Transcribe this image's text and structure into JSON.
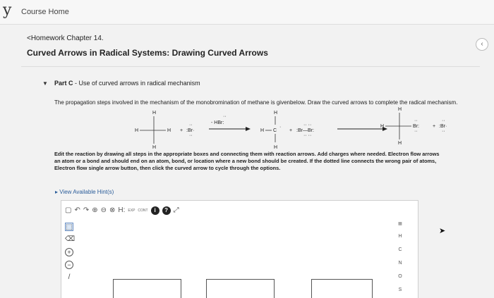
{
  "header": {
    "logo_letter": "y",
    "course_home": "Course Home"
  },
  "nav": {
    "homework_link": "<Homework Chapter 14.",
    "collapse_icon": "chevron-left"
  },
  "page": {
    "title": "Curved Arrows in Radical Systems: Drawing Curved Arrows"
  },
  "part": {
    "label": "Part C",
    "title": " - Use of curved arrows in radical mechanism",
    "prompt": "The propagation steps involved in the mechanism of the monobromination of methane is givenbelow. Draw the curved arrows to complete the radical mechanism."
  },
  "reaction": {
    "plus": "+",
    "above_arrow": "- HBr:",
    "br_radical": ":Br·",
    "br2": ":Br—Br:",
    "h": "H",
    "c": "C",
    "br": "Br:"
  },
  "instructions": [
    "Edit the reaction by drawing all steps in the appropriate boxes and connecting them with reaction arrows. Add charges where needed. Electron flow arrows",
    "an atom or a bond and should end on an atom, bond, or location where a new bond should be created. If the dotted line connects the wrong pair of atoms,",
    "Electron flow single arrow button, then click the curved arrow to cycle through the options."
  ],
  "hint": {
    "label": "View Available Hint(s)"
  },
  "toolbar": {
    "h_dots": "H:",
    "exp": "EXP",
    "cont": "CONT",
    "info": "i",
    "help": "?"
  },
  "elements": [
    "H",
    "C",
    "N",
    "O",
    "S"
  ],
  "periodic_label": "▦"
}
